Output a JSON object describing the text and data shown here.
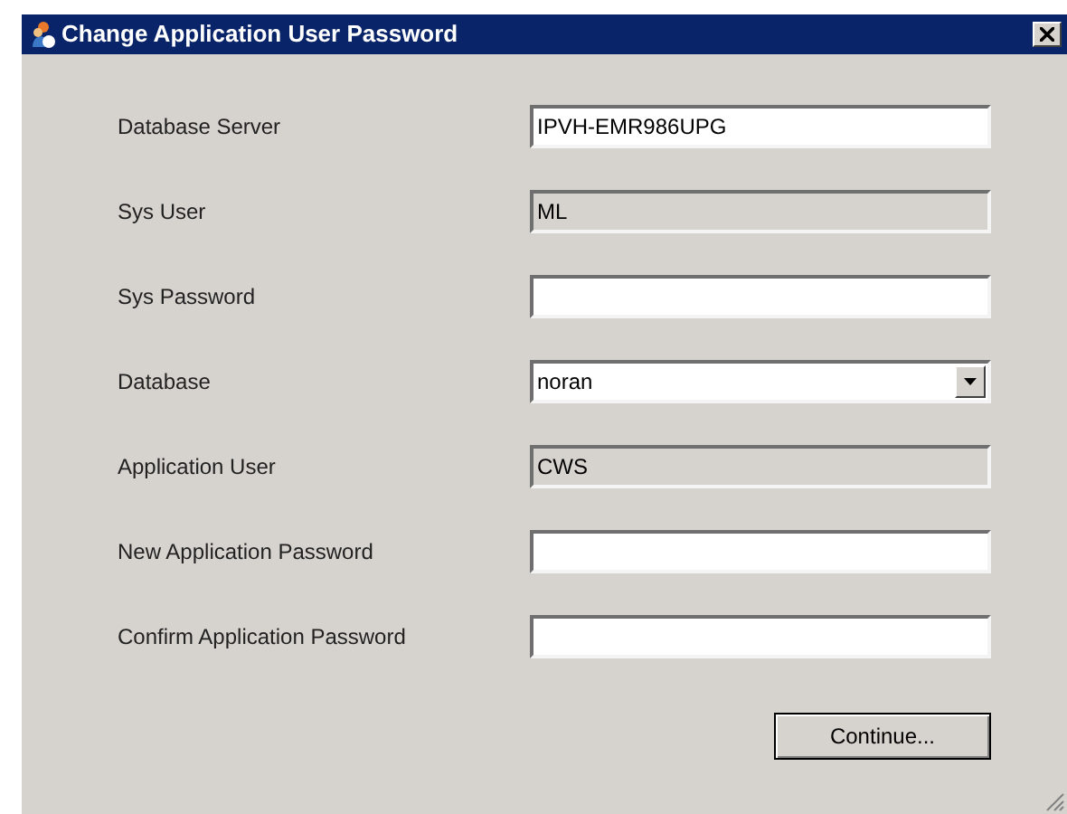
{
  "window": {
    "title": "Change Application User Password"
  },
  "fields": [
    {
      "label": "Database Server",
      "kind": "text",
      "value": "IPVH-EMR986UPG",
      "disabled": false
    },
    {
      "label": "Sys User",
      "kind": "text",
      "value": "ML",
      "disabled": true
    },
    {
      "label": "Sys Password",
      "kind": "text",
      "disabled": false
    },
    {
      "label": "Database",
      "kind": "combo",
      "value": "noran",
      "disabled": false
    },
    {
      "label": "Application User",
      "kind": "text",
      "value": "CWS",
      "disabled": true
    },
    {
      "label": "New Application Password",
      "kind": "text",
      "disabled": false
    },
    {
      "label": "Confirm Application Password",
      "kind": "text",
      "disabled": false
    }
  ],
  "buttons": [
    {
      "label": "Continue..."
    }
  ]
}
